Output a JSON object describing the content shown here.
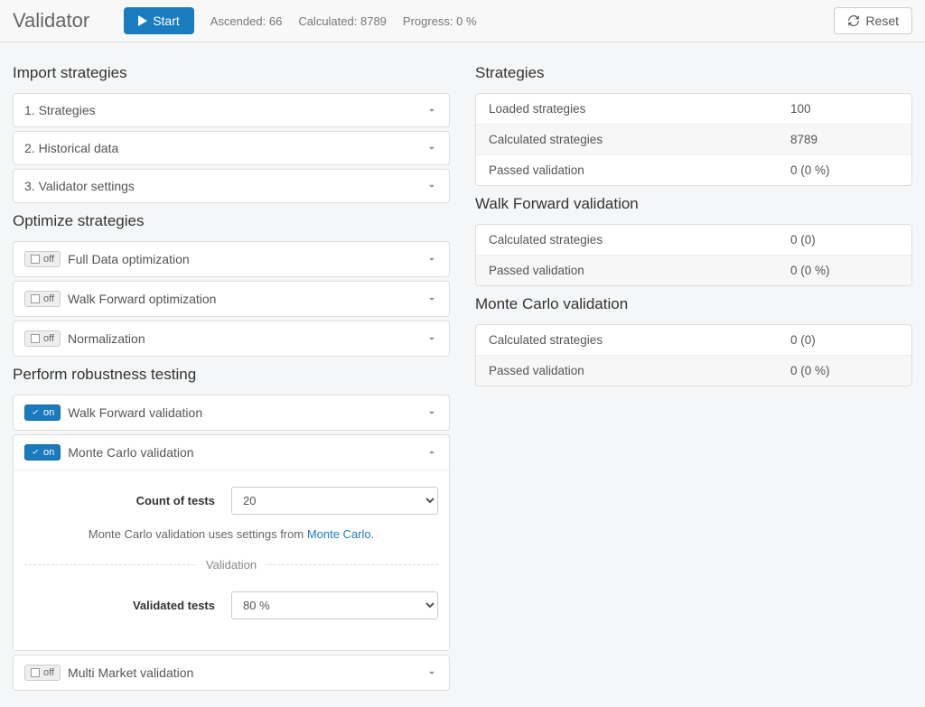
{
  "header": {
    "title": "Validator",
    "start_label": "Start",
    "ascended_label": "Ascended:",
    "ascended_value": "66",
    "calculated_label": "Calculated:",
    "calculated_value": "8789",
    "progress_label": "Progress:",
    "progress_value": "0 %",
    "reset_label": "Reset"
  },
  "left": {
    "import_title": "Import strategies",
    "import_items": [
      {
        "label": "1. Strategies"
      },
      {
        "label": "2. Historical data"
      },
      {
        "label": "3. Validator settings"
      }
    ],
    "optimize_title": "Optimize strategies",
    "optimize_items": [
      {
        "state": "off",
        "label": "Full Data optimization"
      },
      {
        "state": "off",
        "label": "Walk Forward optimization"
      },
      {
        "state": "off",
        "label": "Normalization"
      }
    ],
    "robust_title": "Perform robustness testing",
    "robust_items": [
      {
        "state": "on",
        "label": "Walk Forward validation",
        "expanded": false
      },
      {
        "state": "on",
        "label": "Monte Carlo validation",
        "expanded": true
      },
      {
        "state": "off",
        "label": "Multi Market validation",
        "expanded": false
      }
    ],
    "monte_carlo": {
      "count_label": "Count of tests",
      "count_value": "20",
      "hint_prefix": "Monte Carlo validation uses settings from ",
      "hint_link": "Monte Carlo",
      "divider_label": "Validation",
      "validated_label": "Validated tests",
      "validated_value": "80 %"
    },
    "toggle_off": "off",
    "toggle_on": "on"
  },
  "right": {
    "strategies_title": "Strategies",
    "strategies_rows": [
      {
        "k": "Loaded strategies",
        "v": "100"
      },
      {
        "k": "Calculated strategies",
        "v": "8789"
      },
      {
        "k": "Passed validation",
        "v": "0 (0 %)"
      }
    ],
    "wf_title": "Walk Forward validation",
    "wf_rows": [
      {
        "k": "Calculated strategies",
        "v": "0 (0)"
      },
      {
        "k": "Passed validation",
        "v": "0 (0 %)"
      }
    ],
    "mc_title": "Monte Carlo validation",
    "mc_rows": [
      {
        "k": "Calculated strategies",
        "v": "0 (0)"
      },
      {
        "k": "Passed validation",
        "v": "0 (0 %)"
      }
    ]
  }
}
